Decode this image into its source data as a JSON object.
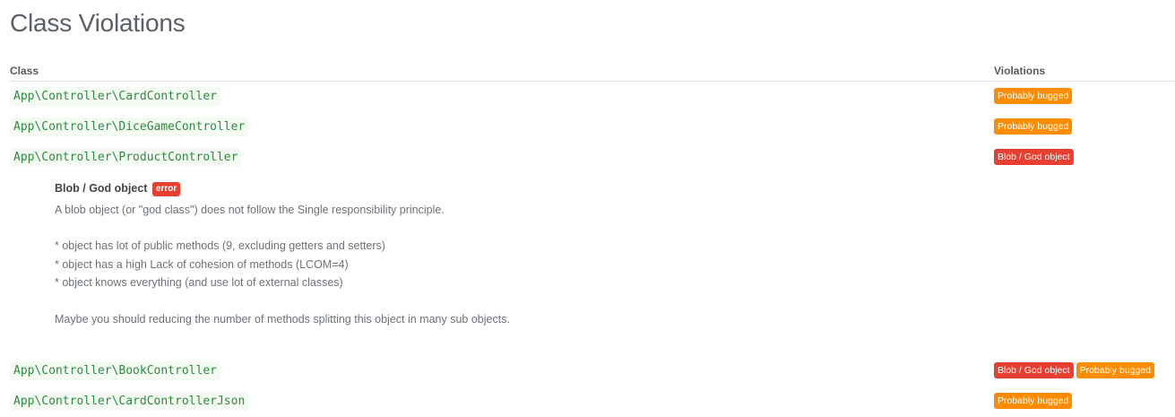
{
  "page": {
    "title": "Class Violations"
  },
  "table": {
    "headers": {
      "class": "Class",
      "violations": "Violations"
    },
    "rows": [
      {
        "class_name": "App\\Controller\\CardController",
        "violations": [
          {
            "label": "Probably bugged",
            "color": "#fd8c00"
          }
        ]
      },
      {
        "class_name": "App\\Controller\\DiceGameController",
        "violations": [
          {
            "label": "Probably bugged",
            "color": "#fd8c00"
          }
        ]
      },
      {
        "class_name": "App\\Controller\\ProductController",
        "violations": [
          {
            "label": "Blob / God object",
            "color": "#e74033"
          }
        ]
      },
      {
        "class_name": "App\\Controller\\BookController",
        "violations": [
          {
            "label": "Blob / God object",
            "color": "#e74033"
          },
          {
            "label": "Probably bugged",
            "color": "#fd8c00"
          }
        ]
      },
      {
        "class_name": "App\\Controller\\CardControllerJson",
        "violations": [
          {
            "label": "Probably bugged",
            "color": "#fd8c00"
          }
        ]
      }
    ]
  },
  "detail": {
    "title": "Blob / God object",
    "severity": "error",
    "description": "A blob object (or \"god class\") does not follow the Single responsibility principle.",
    "points": [
      "* object has lot of public methods (9, excluding getters and setters)",
      "* object has a high Lack of cohesion of methods (LCOM=4)",
      "* object knows everything (and use lot of external classes)"
    ],
    "advice": "Maybe you should reducing the number of methods splitting this object in many sub objects."
  }
}
